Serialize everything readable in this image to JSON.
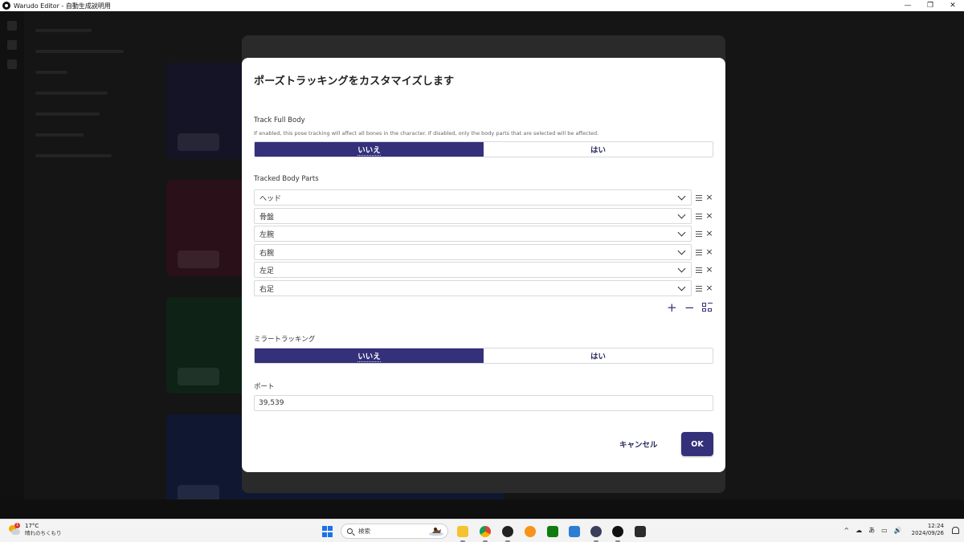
{
  "window": {
    "title": "Warudo Editor - 自動生成説明用",
    "minimize": "—",
    "maximize": "❐",
    "close": "✕"
  },
  "dialog": {
    "title": "ポーズトラッキングをカスタマイズします",
    "track_full_body": {
      "label": "Track Full Body",
      "description": "If enabled, this pose tracking will affect all bones in the character. If disabled, only the body parts that are selected will be affected.",
      "options": [
        "いいえ",
        "はい"
      ],
      "selected": "いいえ"
    },
    "tracked_body_parts": {
      "label": "Tracked Body Parts",
      "items": [
        "ヘッド",
        "骨盤",
        "左腕",
        "右腕",
        "左足",
        "右足"
      ],
      "add": "+",
      "remove": "−"
    },
    "mirror_tracking": {
      "label": "ミラートラッキング",
      "options": [
        "いいえ",
        "はい"
      ],
      "selected": "いいえ"
    },
    "port": {
      "label": "ポート",
      "value": "39,539"
    },
    "cancel_label": "キャンセル",
    "ok_label": "OK"
  },
  "taskbar": {
    "weather": {
      "temp": "17°C",
      "desc": "晴れのちくもり",
      "badge": "1"
    },
    "search_placeholder": "検索",
    "tray": {
      "chevron": "^",
      "ime": "あ",
      "time": "12:24",
      "date": "2024/09/26"
    }
  },
  "colors": {
    "accent": "#34307a",
    "modal_bg": "#ffffff",
    "app_bg": "#151515"
  }
}
